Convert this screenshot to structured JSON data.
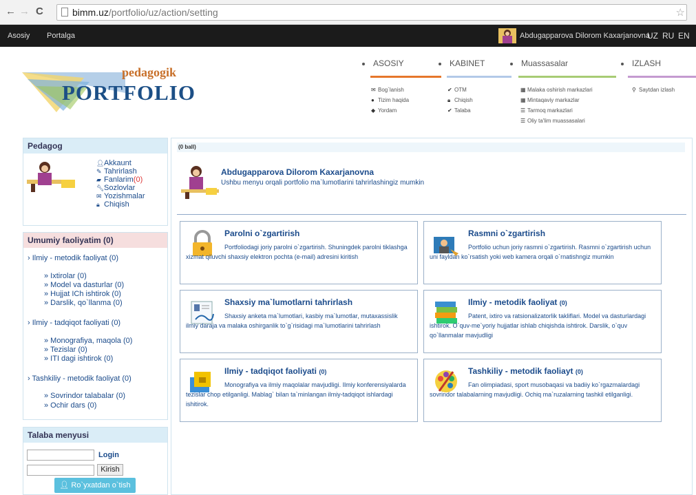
{
  "browser": {
    "url_domain": "bimm.uz",
    "url_path": "/portfolio/uz/action/setting",
    "back_icon": "back-arrow-icon",
    "forward_icon": "forward-arrow-icon",
    "reload_icon": "reload-icon"
  },
  "topbar": {
    "link_home": "Asosiy",
    "link_portal": "Portalga",
    "user_name": "Abdugapparova Dilorom Kaxarjanovna",
    "langs": [
      "UZ",
      "RU",
      "EN"
    ]
  },
  "logo": {
    "line1": "pedagogik",
    "line2": "PORTFOLIO"
  },
  "menu": [
    {
      "title": "ASOSIY",
      "color": "#e6772b",
      "items": [
        {
          "icon": "envelope-icon",
          "label": "Bog`lanish"
        },
        {
          "icon": "comments-icon",
          "label": "Tizim haqida"
        },
        {
          "icon": "tag-icon",
          "label": "Yordam"
        }
      ]
    },
    {
      "title": "KABINET",
      "color": "#b2c9e8",
      "items": [
        {
          "icon": "check-icon",
          "label": "OTM"
        },
        {
          "icon": "lock-icon",
          "label": "Chiqish"
        },
        {
          "icon": "check-icon",
          "label": "Talaba"
        }
      ]
    },
    {
      "title": "Muassasalar",
      "color": "#a7cc74",
      "items": [
        {
          "icon": "grid-icon",
          "label": "Malaka oshirish markazlari"
        },
        {
          "icon": "grid-icon",
          "label": "Mintaqaviy markazlar"
        },
        {
          "icon": "list-icon",
          "label": "Tarmoq markazlari"
        },
        {
          "icon": "list-icon",
          "label": "Oliy ta'lim muassasalari"
        }
      ]
    },
    {
      "title": "IZLASH",
      "color": "#c49ad0",
      "items": [
        {
          "icon": "search-icon",
          "label": "Saytdan izlash"
        }
      ]
    }
  ],
  "pedagog": {
    "header": "Pedagog",
    "links": [
      {
        "icon": "user-icon",
        "label": "Akkaunt"
      },
      {
        "icon": "edit-icon",
        "label": "Tahrirlash"
      },
      {
        "icon": "book-icon",
        "label": "Fanlarim",
        "count": "(0)"
      },
      {
        "icon": "wrench-icon",
        "label": "Sozlovlar"
      },
      {
        "icon": "envelope-icon",
        "label": "Yozishmalar"
      },
      {
        "icon": "lock-icon",
        "label": "Chiqish"
      }
    ]
  },
  "activity": {
    "header": "Umumiy faoliyatim (0)",
    "groups": [
      {
        "title": "› Ilmiy - metodik faoliyat (0)",
        "items": [
          "» Ixtirolar (0)",
          "» Model va dasturlar (0)",
          "» Hujjat ICh ishtirok (0)",
          "» Darslik, qo`llanma (0)"
        ]
      },
      {
        "title": "› Ilmiy - tadqiqot faoliyati (0)",
        "items": [
          "» Monografiya, maqola (0)",
          "» Tezislar (0)",
          "» ITI dagi ishtirok (0)"
        ]
      },
      {
        "title": "› Tashkiliy - metodik faoliyat (0)",
        "items": [
          "» Sovrindor talabalar (0)",
          "» Ochir dars (0)"
        ]
      }
    ]
  },
  "student_menu": {
    "header": "Talaba menyusi",
    "login_label": "Login",
    "login_button": "Kirish",
    "register_button": "Ro`yxatdan o`tish"
  },
  "main": {
    "ball": "(0 ball)",
    "profile_name": "Abdugapparova Dilorom Kaxarjanovna",
    "profile_desc": "Ushbu menyu orqali portfolio ma`lumotlarini tahrirlashingiz mumkin",
    "cards": [
      {
        "title": "Parolni o`zgartirish",
        "suffix": "",
        "icon": "lock-icon",
        "desc": "Portfoliodagi joriy parolni o`zgartirish. Shuningdek parolni tiklashga xizmat qiluvchi shaxsiy elektron pochta (e-mail) adresini kiritish"
      },
      {
        "title": "Rasmni o`zgartirish",
        "suffix": "",
        "icon": "user-photo-icon",
        "desc": "Portfolio uchun joriy rasmni o`zgartirish. Rasmni o`zgartirish uchun uni fayldan ko`rsatish yoki web kamera orqali o`rnatishngiz mumkin"
      },
      {
        "title": "Shaxsiy ma`lumotlarni tahrirlash",
        "suffix": "",
        "icon": "id-card-icon",
        "desc": "Shaxsiy anketa ma`lumotlari, kasbiy ma`lumotlar, mutaxassislik ilmiy daraja va malaka oshirganlik to`g`risidagi ma`lumotlarini tahrirlash"
      },
      {
        "title": "Ilmiy - metodik faoliyat",
        "suffix": "(0)",
        "icon": "books-icon",
        "desc": "Patent, ixtiro va ratsionalizatorlik takliflari. Model va dasturlardagi ishtirok. O`quv-me`yoriy hujjatlar ishlab chiqishda ishtirok. Darslik, o`quv qo`llanmalar mavjudligi"
      },
      {
        "title": "Ilmiy - tadqiqot faoliyati",
        "suffix": "(0)",
        "icon": "folder-lock-icon",
        "desc": "Monografiya va ilmiy maqolalar mavjudligi. Ilmiy konferensiyalarda tezislar chop etilganligi. Mablag` bilan ta`minlangan ilmiy-tadqiqot ishlardagi ishitirok."
      },
      {
        "title": "Tashkiliy - metodik faoliayt",
        "suffix": "(0)",
        "icon": "palette-icon",
        "desc": "Fan olimpiadasi, sport musobaqasi va badiiy ko`rgazmalardagi sovrindor talabalarning mavjudligi. Ochiq ma`ruzalarning tashkil etilganligi."
      }
    ]
  }
}
